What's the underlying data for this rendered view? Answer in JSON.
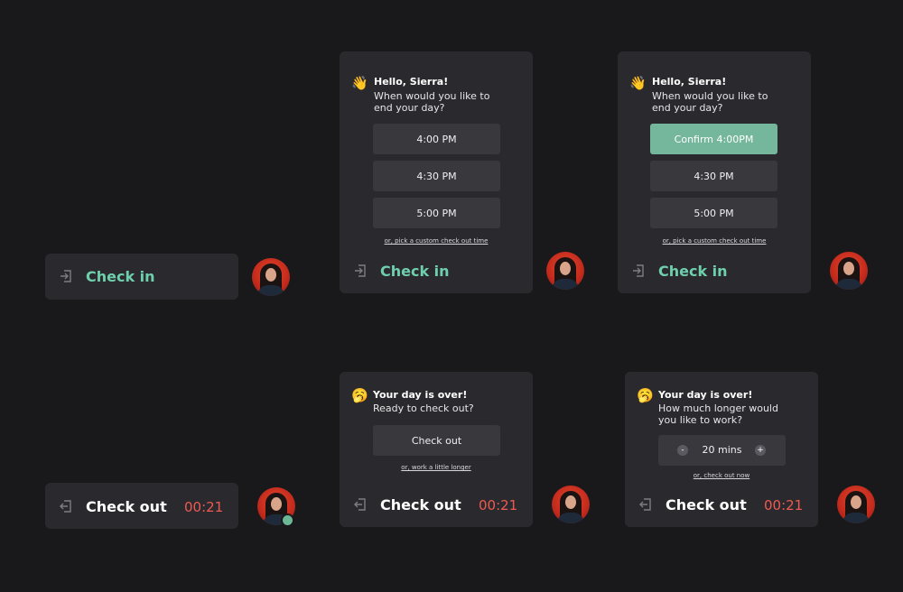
{
  "greeting": {
    "title": "Hello, Sierra!",
    "subtitle": "When would you like to end your day?",
    "emoji": "👋"
  },
  "over": {
    "title": "Your day is over!",
    "subtitle_ready": "Ready to check out?",
    "subtitle_longer": "How much longer would you like to work?",
    "emoji": "🥱"
  },
  "times": [
    "4:00 PM",
    "4:30 PM",
    "5:00 PM"
  ],
  "confirm_label": "Confirm 4:00PM",
  "custom_link": "or, pick a custom check out time",
  "work_longer_link": "or, work a little longer",
  "checkout_now_link": "or, check out now",
  "check_in_label": "Check in",
  "check_out_label": "Check out",
  "timer": "00:21",
  "stepper": {
    "minus": "-",
    "value": "20 mins",
    "plus": "+"
  },
  "icons": {
    "check_in": "sign-in-icon",
    "check_out": "sign-out-icon"
  },
  "colors": {
    "background": "#19191b",
    "panel": "#2a2a2e",
    "option": "#38383d",
    "accent_green": "#6fcfac",
    "confirm": "#75b79c",
    "timer_red": "#ee5a52",
    "online": "#6cb796"
  }
}
